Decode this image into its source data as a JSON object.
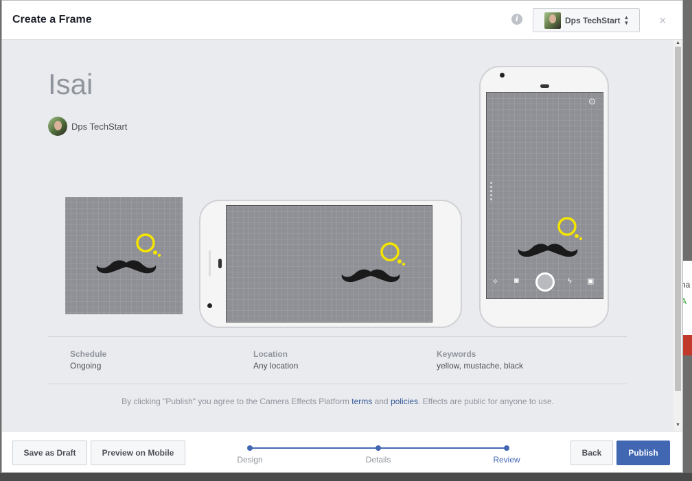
{
  "header": {
    "title": "Create a Frame",
    "info_icon": "i",
    "page_selector": "Dps TechStart",
    "close": "×"
  },
  "effect": {
    "name": "Isai",
    "owner": "Dps TechStart"
  },
  "details": {
    "schedule_label": "Schedule",
    "schedule_value": "Ongoing",
    "location_label": "Location",
    "location_value": "Any location",
    "keywords_label": "Keywords",
    "keywords_value": "yellow, mustache, black"
  },
  "disclaimer": {
    "pre": "By clicking \"Publish\" you agree to the Camera Effects Platform ",
    "terms": "terms",
    "mid": " and ",
    "policies": "policies",
    "post": ". Effects are public for anyone to use."
  },
  "footer": {
    "save_draft": "Save as Draft",
    "preview_mobile": "Preview on Mobile",
    "steps": [
      "Design",
      "Details",
      "Review"
    ],
    "active_step": "Review",
    "back": "Back",
    "publish": "Publish"
  },
  "colors": {
    "accent": "#4267b2",
    "mustache": "#1a1a1a",
    "bubble": "#f4e400",
    "preview_bg": "#8e9096"
  },
  "icons": {
    "phone_bottom_left": [
      "magic-wand-icon",
      "camera-icon"
    ],
    "phone_bottom_right": [
      "flash-icon",
      "gallery-icon"
    ],
    "phone_top_right": "arrow-circle-icon"
  }
}
